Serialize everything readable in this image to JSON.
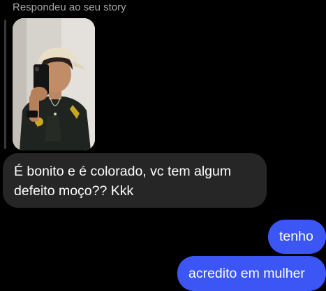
{
  "reply": {
    "caption": "Respondeu ao seu story"
  },
  "messages": {
    "received_text": "É bonito e é colorado, vc tem algum defeito moço?? Kkk",
    "sent": [
      "tenho",
      "acredito em mulher"
    ]
  },
  "colors": {
    "background": "#000000",
    "received_bubble": "#262626",
    "sent_bubble": "#3b56f5",
    "caption_text": "#a8a8a8"
  }
}
